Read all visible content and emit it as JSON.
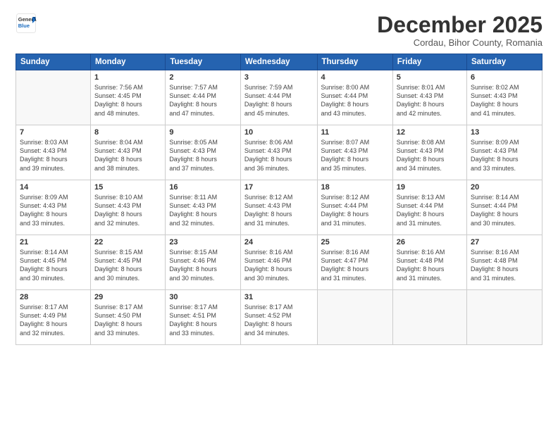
{
  "logo": {
    "general": "General",
    "blue": "Blue"
  },
  "header": {
    "month": "December 2025",
    "location": "Cordau, Bihor County, Romania"
  },
  "weekdays": [
    "Sunday",
    "Monday",
    "Tuesday",
    "Wednesday",
    "Thursday",
    "Friday",
    "Saturday"
  ],
  "weeks": [
    [
      {
        "day": "",
        "info": ""
      },
      {
        "day": "1",
        "info": "Sunrise: 7:56 AM\nSunset: 4:45 PM\nDaylight: 8 hours\nand 48 minutes."
      },
      {
        "day": "2",
        "info": "Sunrise: 7:57 AM\nSunset: 4:44 PM\nDaylight: 8 hours\nand 47 minutes."
      },
      {
        "day": "3",
        "info": "Sunrise: 7:59 AM\nSunset: 4:44 PM\nDaylight: 8 hours\nand 45 minutes."
      },
      {
        "day": "4",
        "info": "Sunrise: 8:00 AM\nSunset: 4:44 PM\nDaylight: 8 hours\nand 43 minutes."
      },
      {
        "day": "5",
        "info": "Sunrise: 8:01 AM\nSunset: 4:43 PM\nDaylight: 8 hours\nand 42 minutes."
      },
      {
        "day": "6",
        "info": "Sunrise: 8:02 AM\nSunset: 4:43 PM\nDaylight: 8 hours\nand 41 minutes."
      }
    ],
    [
      {
        "day": "7",
        "info": "Sunrise: 8:03 AM\nSunset: 4:43 PM\nDaylight: 8 hours\nand 39 minutes."
      },
      {
        "day": "8",
        "info": "Sunrise: 8:04 AM\nSunset: 4:43 PM\nDaylight: 8 hours\nand 38 minutes."
      },
      {
        "day": "9",
        "info": "Sunrise: 8:05 AM\nSunset: 4:43 PM\nDaylight: 8 hours\nand 37 minutes."
      },
      {
        "day": "10",
        "info": "Sunrise: 8:06 AM\nSunset: 4:43 PM\nDaylight: 8 hours\nand 36 minutes."
      },
      {
        "day": "11",
        "info": "Sunrise: 8:07 AM\nSunset: 4:43 PM\nDaylight: 8 hours\nand 35 minutes."
      },
      {
        "day": "12",
        "info": "Sunrise: 8:08 AM\nSunset: 4:43 PM\nDaylight: 8 hours\nand 34 minutes."
      },
      {
        "day": "13",
        "info": "Sunrise: 8:09 AM\nSunset: 4:43 PM\nDaylight: 8 hours\nand 33 minutes."
      }
    ],
    [
      {
        "day": "14",
        "info": "Sunrise: 8:09 AM\nSunset: 4:43 PM\nDaylight: 8 hours\nand 33 minutes."
      },
      {
        "day": "15",
        "info": "Sunrise: 8:10 AM\nSunset: 4:43 PM\nDaylight: 8 hours\nand 32 minutes."
      },
      {
        "day": "16",
        "info": "Sunrise: 8:11 AM\nSunset: 4:43 PM\nDaylight: 8 hours\nand 32 minutes."
      },
      {
        "day": "17",
        "info": "Sunrise: 8:12 AM\nSunset: 4:43 PM\nDaylight: 8 hours\nand 31 minutes."
      },
      {
        "day": "18",
        "info": "Sunrise: 8:12 AM\nSunset: 4:44 PM\nDaylight: 8 hours\nand 31 minutes."
      },
      {
        "day": "19",
        "info": "Sunrise: 8:13 AM\nSunset: 4:44 PM\nDaylight: 8 hours\nand 31 minutes."
      },
      {
        "day": "20",
        "info": "Sunrise: 8:14 AM\nSunset: 4:44 PM\nDaylight: 8 hours\nand 30 minutes."
      }
    ],
    [
      {
        "day": "21",
        "info": "Sunrise: 8:14 AM\nSunset: 4:45 PM\nDaylight: 8 hours\nand 30 minutes."
      },
      {
        "day": "22",
        "info": "Sunrise: 8:15 AM\nSunset: 4:45 PM\nDaylight: 8 hours\nand 30 minutes."
      },
      {
        "day": "23",
        "info": "Sunrise: 8:15 AM\nSunset: 4:46 PM\nDaylight: 8 hours\nand 30 minutes."
      },
      {
        "day": "24",
        "info": "Sunrise: 8:16 AM\nSunset: 4:46 PM\nDaylight: 8 hours\nand 30 minutes."
      },
      {
        "day": "25",
        "info": "Sunrise: 8:16 AM\nSunset: 4:47 PM\nDaylight: 8 hours\nand 31 minutes."
      },
      {
        "day": "26",
        "info": "Sunrise: 8:16 AM\nSunset: 4:48 PM\nDaylight: 8 hours\nand 31 minutes."
      },
      {
        "day": "27",
        "info": "Sunrise: 8:16 AM\nSunset: 4:48 PM\nDaylight: 8 hours\nand 31 minutes."
      }
    ],
    [
      {
        "day": "28",
        "info": "Sunrise: 8:17 AM\nSunset: 4:49 PM\nDaylight: 8 hours\nand 32 minutes."
      },
      {
        "day": "29",
        "info": "Sunrise: 8:17 AM\nSunset: 4:50 PM\nDaylight: 8 hours\nand 33 minutes."
      },
      {
        "day": "30",
        "info": "Sunrise: 8:17 AM\nSunset: 4:51 PM\nDaylight: 8 hours\nand 33 minutes."
      },
      {
        "day": "31",
        "info": "Sunrise: 8:17 AM\nSunset: 4:52 PM\nDaylight: 8 hours\nand 34 minutes."
      },
      {
        "day": "",
        "info": ""
      },
      {
        "day": "",
        "info": ""
      },
      {
        "day": "",
        "info": ""
      }
    ]
  ]
}
